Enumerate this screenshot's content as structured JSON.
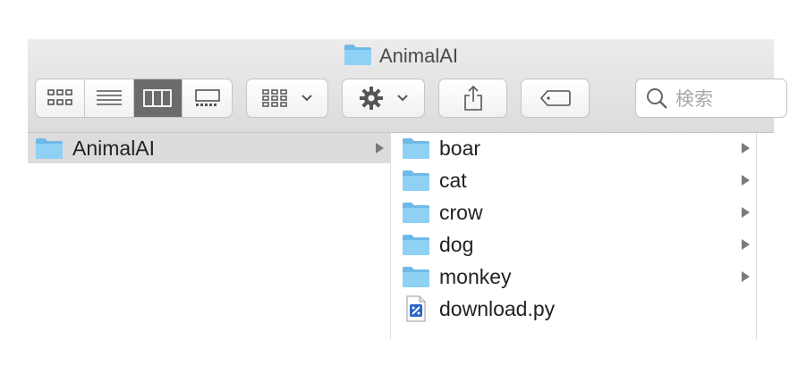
{
  "window": {
    "title": "AnimalAI"
  },
  "toolbar": {
    "view_modes": [
      "icon-view",
      "list-view",
      "column-view",
      "gallery-view"
    ],
    "active_view": "column-view",
    "search_placeholder": "検索"
  },
  "columns": {
    "first": {
      "items": [
        {
          "label": "AnimalAI",
          "type": "folder",
          "selected": true
        }
      ]
    },
    "second": {
      "items": [
        {
          "label": "boar",
          "type": "folder"
        },
        {
          "label": "cat",
          "type": "folder"
        },
        {
          "label": "crow",
          "type": "folder"
        },
        {
          "label": "dog",
          "type": "folder"
        },
        {
          "label": "monkey",
          "type": "folder"
        },
        {
          "label": "download.py",
          "type": "python-file"
        }
      ]
    }
  },
  "colors": {
    "folder": "#7ec3ee",
    "selected_row": "#dcdcdc",
    "active_segment": "#6b6b6b"
  }
}
